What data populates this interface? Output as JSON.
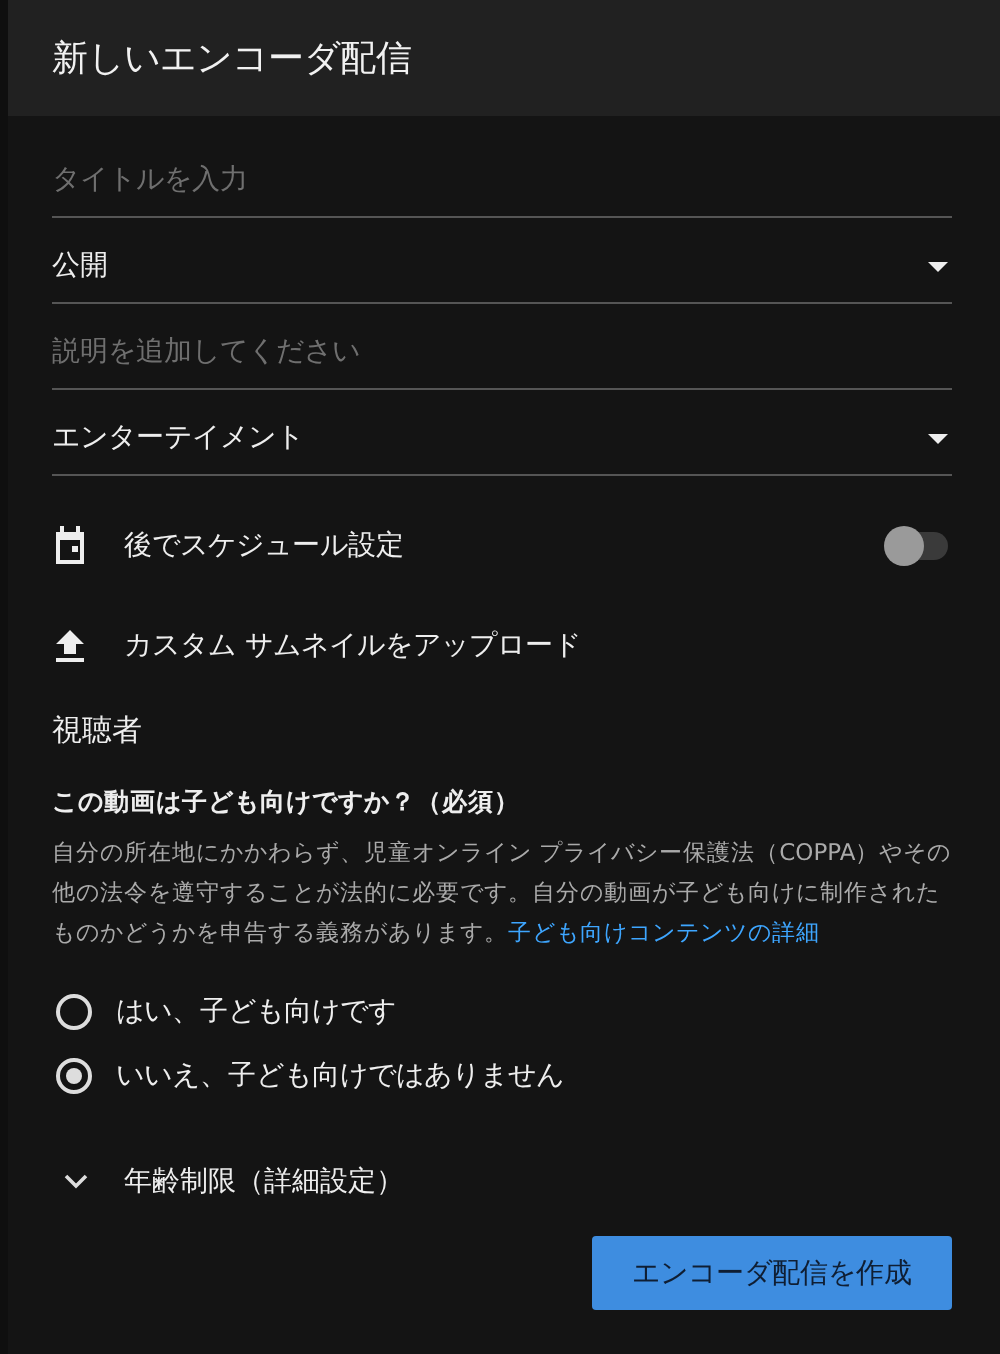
{
  "dialog": {
    "title": "新しいエンコーダ配信"
  },
  "fields": [
    {
      "kind": "text",
      "placeholder": "タイトルを入力"
    },
    {
      "kind": "select",
      "value": "公開"
    },
    {
      "kind": "text",
      "placeholder": "説明を追加してください"
    },
    {
      "kind": "select",
      "value": "エンターテイメント"
    }
  ],
  "schedule": {
    "label": "後でスケジュール設定",
    "on": false
  },
  "upload": {
    "label": "カスタム サムネイルをアップロード"
  },
  "audience": {
    "heading": "視聴者",
    "question": "この動画は子ども向けですか？（必須）",
    "description": "自分の所在地にかかわらず、児童オンライン プライバシー保護法（COPPA）やその他の法令を遵守することが法的に必要です。自分の動画が子ども向けに制作されたものかどうかを申告する義務があります。",
    "link": "子ども向けコンテンツの詳細",
    "options": [
      {
        "label": "はい、子ども向けです",
        "selected": false
      },
      {
        "label": "いいえ、子ども向けではありません",
        "selected": true
      }
    ]
  },
  "age_restriction": {
    "label": "年齢制限（詳細設定）",
    "expanded": false
  },
  "create_button": "エンコーダ配信を作成"
}
